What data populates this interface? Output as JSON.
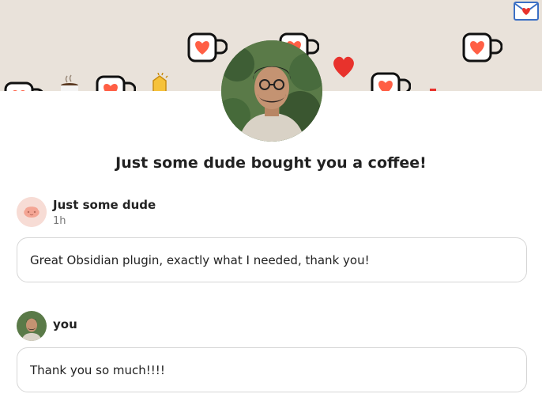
{
  "banner": {
    "icons": [
      "coffee-mug-heart-icon",
      "heart-icon",
      "coffee-cup-icon",
      "clapping-hands-icon",
      "envelope-heart-icon"
    ],
    "colors": {
      "background": "#e9e2da",
      "mug_heart": "#ff5f45",
      "heart": "#e8322c"
    }
  },
  "headline": "Just some dude bought you a coffee!",
  "supporter": {
    "name": "Just some dude",
    "time": "1h",
    "message": "Great Obsidian plugin, exactly what I needed, thank you!"
  },
  "reply": {
    "name": "you",
    "message": "Thank you so much!!!!"
  }
}
